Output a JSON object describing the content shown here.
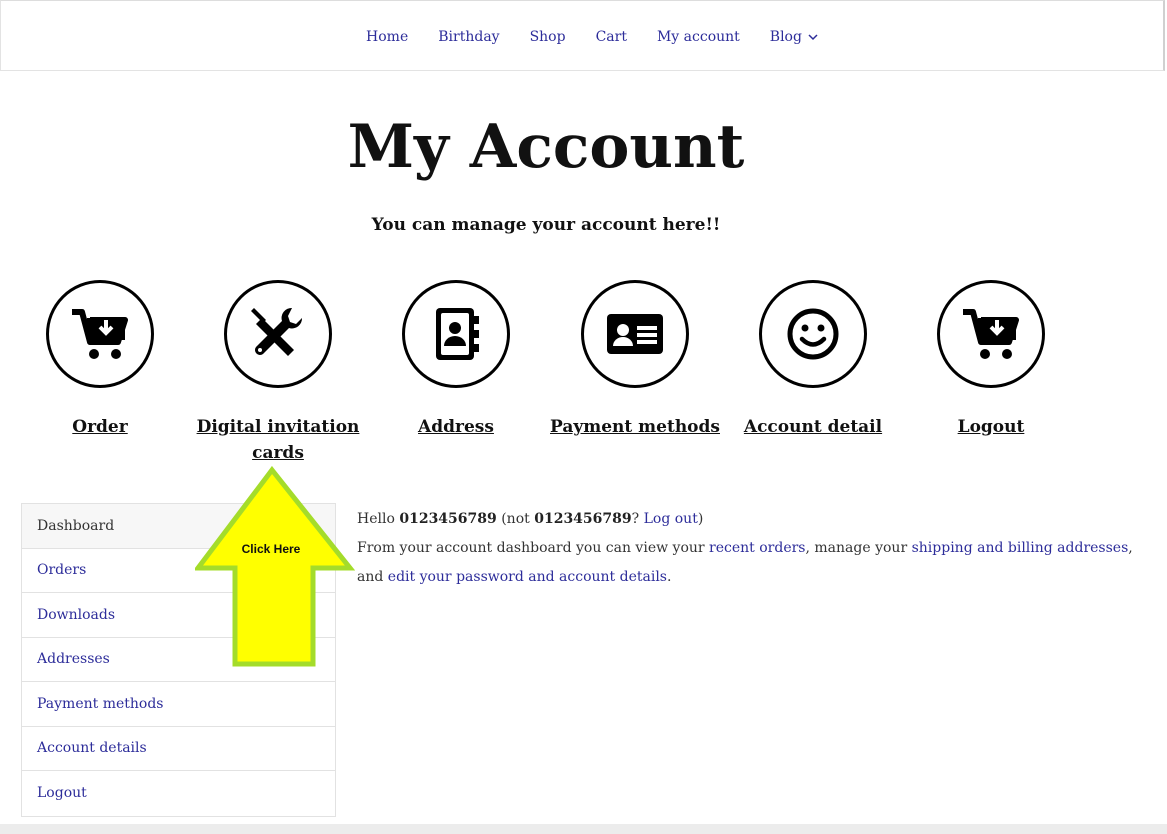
{
  "nav": {
    "items": [
      {
        "label": "Home"
      },
      {
        "label": "Birthday"
      },
      {
        "label": "Shop"
      },
      {
        "label": "Cart"
      },
      {
        "label": "My account"
      },
      {
        "label": "Blog"
      }
    ]
  },
  "page": {
    "title": "My Account",
    "subtitle": "You can manage your account here!!"
  },
  "tiles": [
    {
      "label": "Order",
      "icon": "cart-download-icon"
    },
    {
      "label": "Digital invitation cards",
      "icon": "tools-icon"
    },
    {
      "label": "Address",
      "icon": "address-book-icon"
    },
    {
      "label": "Payment methods",
      "icon": "id-card-icon"
    },
    {
      "label": "Account detail",
      "icon": "smile-icon"
    },
    {
      "label": "Logout",
      "icon": "cart-download-icon"
    }
  ],
  "sidebar": {
    "items": [
      {
        "label": "Dashboard"
      },
      {
        "label": "Orders"
      },
      {
        "label": "Downloads"
      },
      {
        "label": "Addresses"
      },
      {
        "label": "Payment methods"
      },
      {
        "label": "Account details"
      },
      {
        "label": "Logout"
      }
    ]
  },
  "dashboard": {
    "hello": "Hello",
    "username": "0123456789",
    "not_prefix": "(not",
    "username2": "0123456789",
    "question": "?",
    "logout_link": "Log out",
    "close_paren": ")",
    "line2_a": "From your account dashboard you can view your",
    "recent_orders": "recent orders",
    "line2_b": ", manage your",
    "addresses_link": "shipping and billing addresses",
    "line2_c": ",",
    "line3_a": "and",
    "password_link": "edit your password and account details",
    "line3_b": "."
  },
  "annotation": {
    "label": "Click Here",
    "fill": "#ffff00",
    "stroke": "#a4dc2a"
  }
}
